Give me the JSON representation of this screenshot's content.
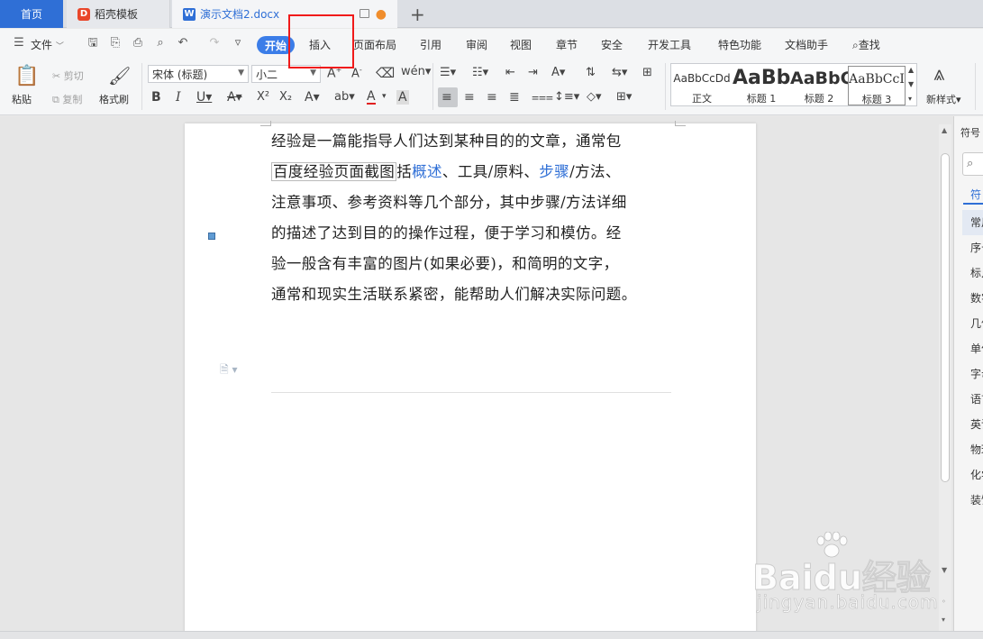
{
  "tabs": {
    "home": "首页",
    "template": "稻壳模板",
    "document": "演示文档2.docx",
    "modified_dot": "●",
    "new_tab": "+"
  },
  "menu": {
    "file": "文件",
    "active": "开始",
    "items": [
      "插入",
      "页面布局",
      "引用",
      "审阅",
      "视图",
      "章节",
      "安全",
      "开发工具",
      "特色功能",
      "文档助手"
    ],
    "search": "查找"
  },
  "ribbon": {
    "paste": "粘贴",
    "cut": "剪切",
    "copy": "复制",
    "format_painter": "格式刷",
    "font_name": "宋体 (标题)",
    "font_size": "小二",
    "new_style": "新样式",
    "styles": [
      {
        "preview": "AaBbCcDd",
        "label": "正文"
      },
      {
        "preview": "AaBb",
        "label": "标题 1"
      },
      {
        "preview": "AaBbC",
        "label": "标题 2"
      },
      {
        "preview": "AaBbCcI",
        "label": "标题 3"
      }
    ]
  },
  "document": {
    "lines": [
      "经验是一篇能指导人们达到某种目的的文章，通常包",
      "注意事项、参考资料等几个部分，其中步骤/方法详细",
      "的描述了达到目的的操作过程，便于学习和模仿。经",
      "验一般含有丰富的图片(如果必要)，和简明的文字，",
      "通常和现实生活联系紧密，能帮助人们解决实际问题。"
    ],
    "line2": {
      "boxed": "百度经验页面截图",
      "pre": "括",
      "link1": "概述",
      "mid": "、工具/原料、",
      "link2": "步骤",
      "post": "/方法、"
    }
  },
  "side_panel": {
    "title": "符号",
    "tab": "符",
    "items": [
      "常用",
      "序号",
      "标点",
      "数字",
      "几何",
      "单位",
      "字母",
      "语言",
      "英语",
      "物理",
      "化学",
      "装饰"
    ]
  },
  "watermark": {
    "brand": "Baidu经验",
    "url": "jingyan.baidu.com"
  },
  "colors": {
    "accent": "#2f6fd6",
    "highlight_box": "#f01a1a"
  }
}
